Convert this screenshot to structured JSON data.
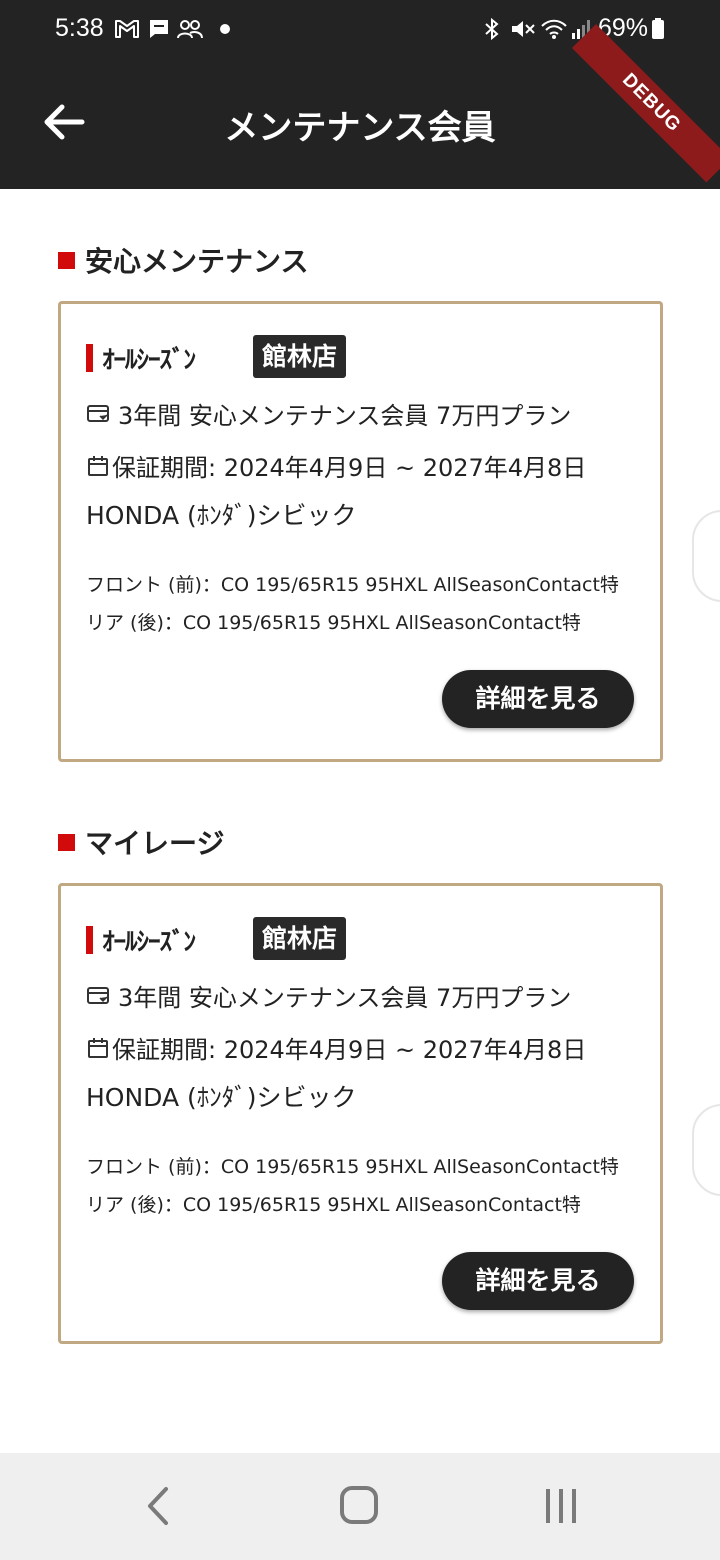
{
  "status_bar": {
    "time": "5:38",
    "battery": "69%",
    "icons": [
      "gmail-icon",
      "chat-icon",
      "group-icon",
      "dot-icon",
      "bluetooth-icon",
      "mute-icon",
      "wifi-icon",
      "signal-icon",
      "battery-icon"
    ]
  },
  "debug_banner": "DEBUG",
  "app_bar": {
    "title": "メンテナンス会員",
    "back_icon": "arrow-left-icon"
  },
  "sections": [
    {
      "title": "安心メンテナンス",
      "card": {
        "brand": "ｵｰﾙｼｰｽﾞﾝ",
        "store": "館林店",
        "plan": "3年間 安心メンテナンス会員 7万円プラン",
        "period": "保証期間: 2024年4月9日 ~ 2027年4月8日",
        "car": "HONDA (ﾎﾝﾀﾞ)シビック",
        "tire_front": "フロント (前)：CO 195/65R15 95HXL AllSeasonContact特",
        "tire_rear": "リア (後)：CO 195/65R15 95HXL AllSeasonContact特",
        "button": "詳細を見る"
      }
    },
    {
      "title": "マイレージ",
      "card": {
        "brand": "ｵｰﾙｼｰｽﾞﾝ",
        "store": "館林店",
        "plan": "3年間 安心メンテナンス会員 7万円プラン",
        "period": "保証期間: 2024年4月9日 ~ 2027年4月8日",
        "car": "HONDA (ﾎﾝﾀﾞ)シビック",
        "tire_front": "フロント (前)：CO 195/65R15 95HXL AllSeasonContact特",
        "tire_rear": "リア (後)：CO 195/65R15 95HXL AllSeasonContact特",
        "button": "詳細を見る"
      }
    }
  ],
  "colors": {
    "app_bar": "#232323",
    "accent_red": "#d10b0b",
    "card_border": "#c0a882",
    "badge": "#2a2a2a",
    "debug_ribbon": "#8e1b1b",
    "nav_bar": "#efefef"
  },
  "nav_bar": {
    "icons": [
      "nav-back-icon",
      "nav-home-icon",
      "nav-recents-icon"
    ]
  }
}
